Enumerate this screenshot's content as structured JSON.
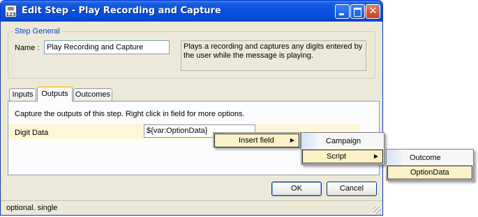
{
  "window": {
    "title": "Edit Step - Play Recording and Capture",
    "icon_text": "123"
  },
  "step_general": {
    "legend": "Step General",
    "name_label": "Name :",
    "name_value": "Play Recording and Capture",
    "description_line1": "Plays a recording and captures any digits entered by",
    "description_line2": "the user while the message is playing."
  },
  "tabs": [
    "Inputs",
    "Outputs",
    "Outcomes"
  ],
  "outputs_panel": {
    "hint": "Capture the outputs of this step.  Right click in field for more options.",
    "row_label": "Digit Data",
    "row_value": "${var:OptionData}"
  },
  "buttons": {
    "ok": "OK",
    "cancel": "Cancel"
  },
  "status": {
    "text": "optional. single"
  },
  "context_menu": {
    "level1": [
      {
        "label": "Insert field",
        "arrow": "▶"
      }
    ],
    "level2": [
      {
        "label": "Campaign",
        "arrow": ""
      },
      {
        "label": "Script",
        "arrow": "▶"
      }
    ],
    "level3": [
      {
        "label": "Outcome"
      },
      {
        "label": "OptionData"
      }
    ]
  }
}
